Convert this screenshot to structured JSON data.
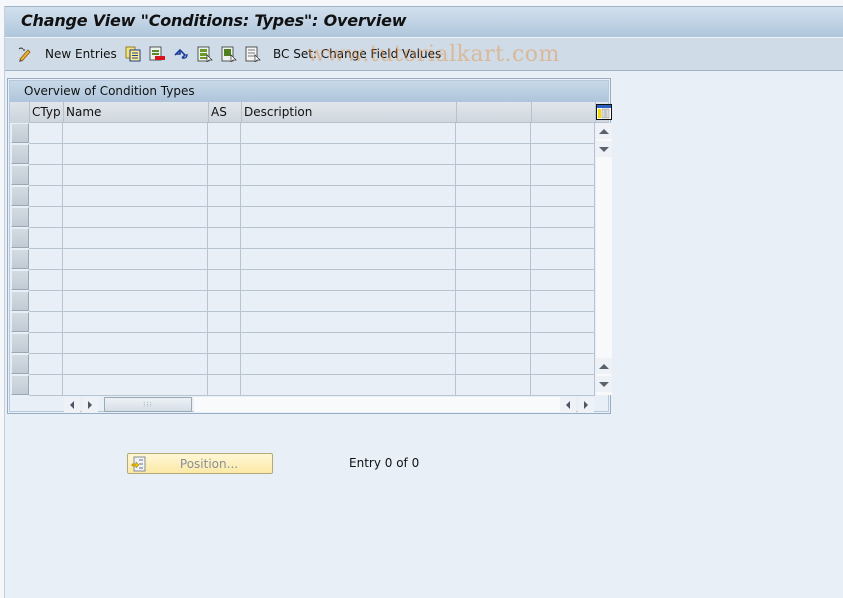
{
  "window": {
    "title": "Change View \"Conditions: Types\": Overview"
  },
  "toolbar": {
    "items": [
      {
        "icon": "edit-pencil-icon",
        "label": ""
      },
      {
        "icon": "",
        "label": "New Entries"
      },
      {
        "icon": "copy-as-icon",
        "label": ""
      },
      {
        "icon": "delete-icon",
        "label": ""
      },
      {
        "icon": "undo-change-icon",
        "label": ""
      },
      {
        "icon": "select-all-icon",
        "label": ""
      },
      {
        "icon": "select-block-icon",
        "label": ""
      },
      {
        "icon": "deselect-all-icon",
        "label": ""
      },
      {
        "icon": "",
        "label": "BC Set: Change Field Values"
      }
    ]
  },
  "watermark": "www.tutorialkart.com",
  "table": {
    "title": "Overview of Condition Types",
    "columns": [
      "CTyp",
      "Name",
      "AS",
      "Description",
      "",
      ""
    ],
    "row_count": 13,
    "rows": []
  },
  "footer": {
    "position_button": "Position...",
    "entry_info": "Entry 0 of 0"
  },
  "colors": {
    "title_bar": "#afc6dc",
    "toolbar": "#cfdce7",
    "background": "#e8eff7",
    "position_button": "#fbe9a6"
  }
}
